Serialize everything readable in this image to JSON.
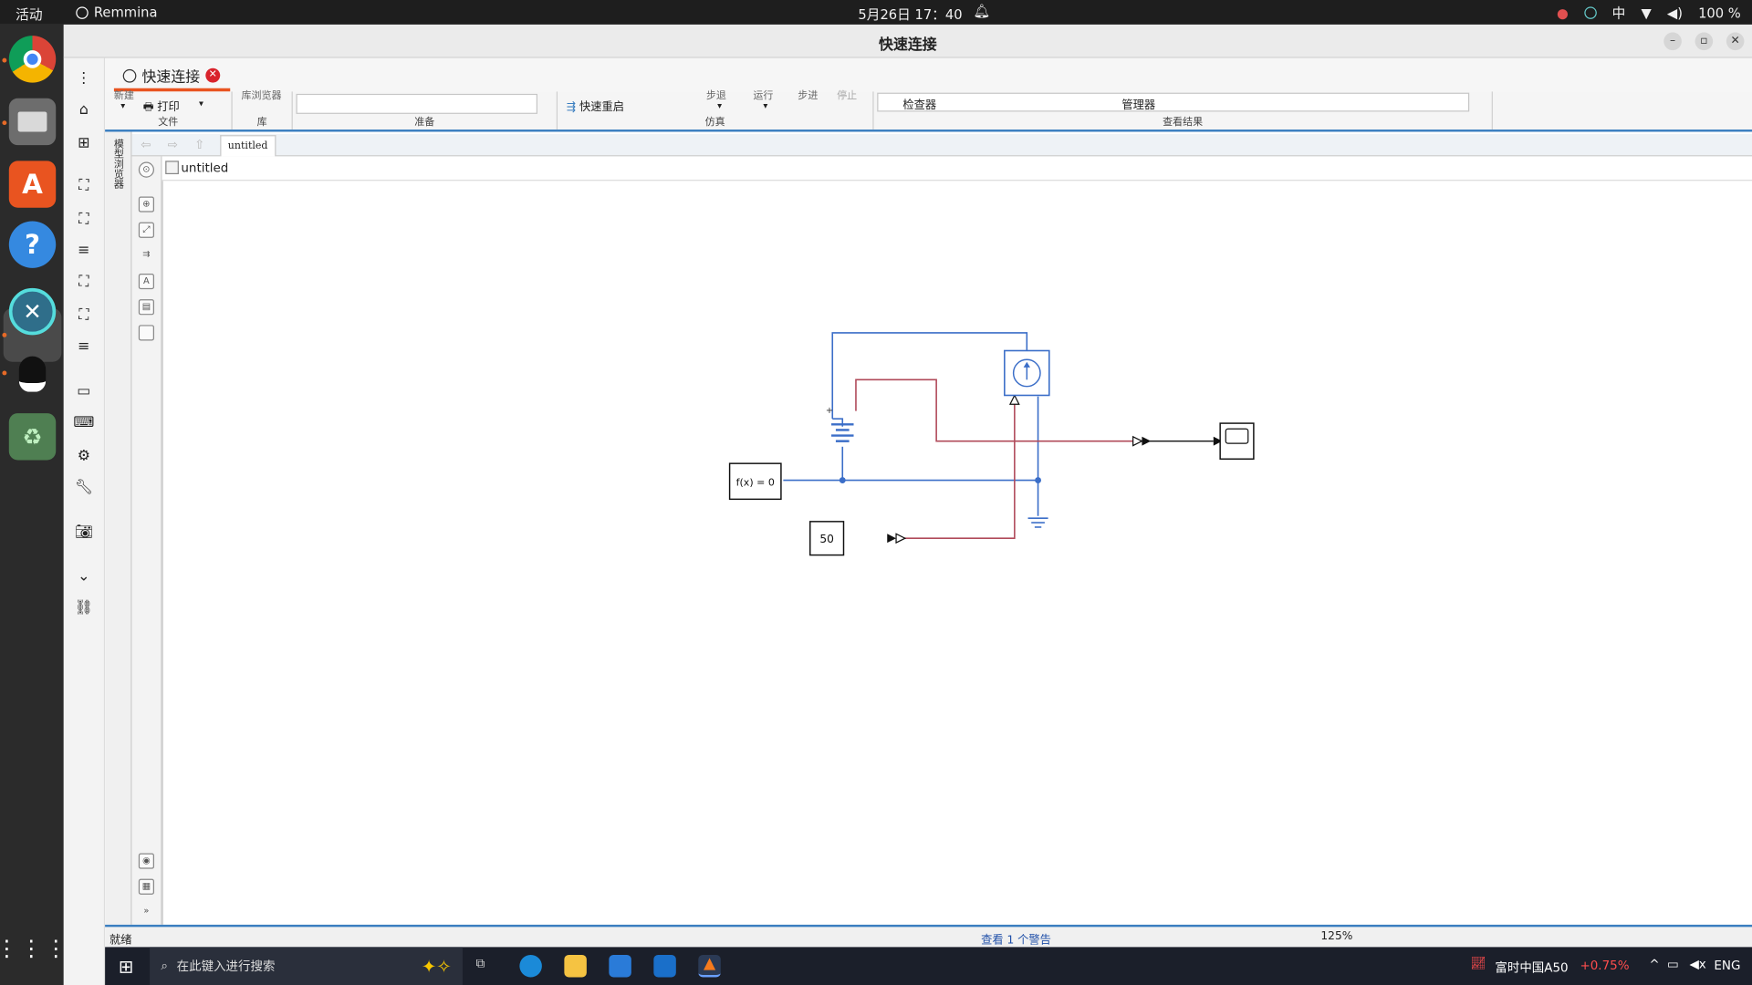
{
  "topbar": {
    "activities": "活动",
    "app_name": "Remmina",
    "clock": "5月26日 17：40",
    "input_method": "中",
    "battery": "100 %"
  },
  "window": {
    "title": "快速连接",
    "tab_label": "快速连接"
  },
  "ribbon": {
    "new_label": "新建",
    "print_label": "打印",
    "file_section": "文件",
    "library_label": "库浏览器",
    "library_section": "库",
    "prepare_section": "准备",
    "fast_restart": "快速重启",
    "step_back": "步退",
    "run": "运行",
    "step_forward": "步进",
    "stop": "停止",
    "simulation_section": "仿真",
    "inspector": "检查器",
    "manager": "管理器",
    "results_section": "查看结果"
  },
  "model_browser_label": "模型浏览器",
  "nav": {
    "tab": "untitled",
    "path": "untitled"
  },
  "diagram": {
    "fx_block": "f(x) = 0",
    "constant_block": "50"
  },
  "status": {
    "ready": "就绪",
    "warnings": "查看 1 个警告",
    "zoom": "125%"
  },
  "taskbar": {
    "search_placeholder": "在此键入进行搜索",
    "stock_name": "富时中国A50",
    "stock_change": "+0.75%",
    "lang": "ENG"
  },
  "colors": {
    "accent": "#e95420",
    "matlab_blue": "#3a7ec0",
    "wire_blue": "#3b6ec8",
    "wire_red": "#b04a5a",
    "stock_red": "#ff4d4d"
  }
}
